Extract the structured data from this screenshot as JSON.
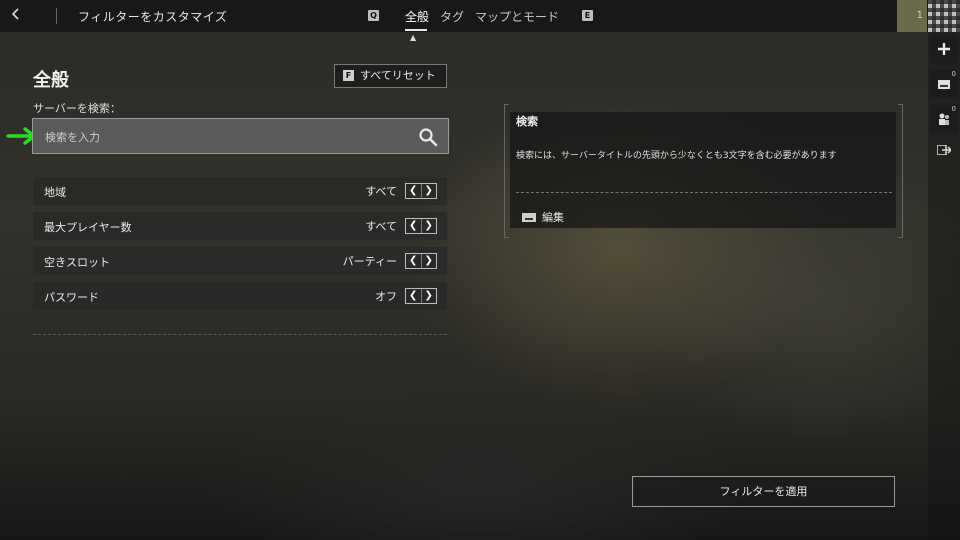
{
  "header": {
    "back_icon": "chevron-left-icon",
    "title": "フィルターをカスタマイズ",
    "prev_key": "Q",
    "next_key": "E",
    "tabs": [
      {
        "label": "全般",
        "active": true
      },
      {
        "label": "タグ",
        "active": false
      },
      {
        "label": "マップとモード",
        "active": false
      }
    ]
  },
  "rail": {
    "level": "1",
    "add_icon": "plus-icon",
    "inbox_badge": "0",
    "friends_badge": "0",
    "exit_icon": "exit-icon"
  },
  "general": {
    "section_title": "全般",
    "reset_key": "F",
    "reset_label": "すべてリセット",
    "search_label": "サーバーを検索：",
    "search_placeholder": "検索を入力",
    "filters": [
      {
        "label": "地域",
        "value": "すべて"
      },
      {
        "label": "最大プレイヤー数",
        "value": "すべて"
      },
      {
        "label": "空きスロット",
        "value": "パーティー"
      },
      {
        "label": "パスワード",
        "value": "オフ"
      }
    ]
  },
  "info": {
    "title": "検索",
    "body": "検索には、サーバータイトルの先頭から少なくとも3文字を含む必要があります",
    "edit_label": "編集"
  },
  "apply_label": "フィルターを適用",
  "colors": {
    "highlight_arrow": "#22dd22",
    "field_bg": "#5a5a5a",
    "row_bg": "#282828"
  }
}
